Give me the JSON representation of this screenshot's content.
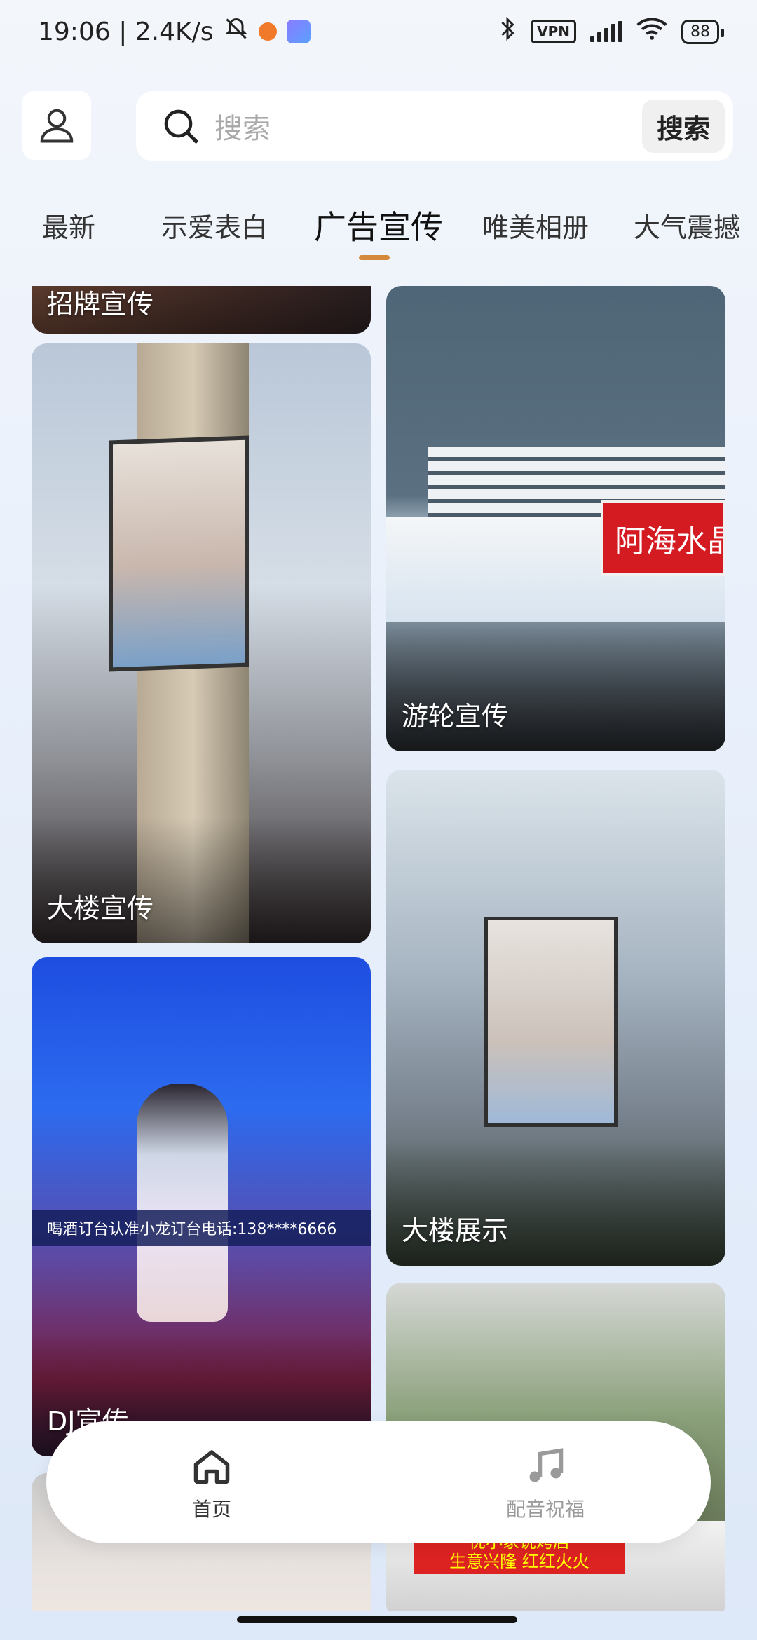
{
  "status_bar": {
    "time_speed": "19:06 | 2.4K/s",
    "vpn": "VPN",
    "battery": "88"
  },
  "search": {
    "placeholder": "搜索",
    "button_label": "搜索"
  },
  "tabs": [
    {
      "label": "最新"
    },
    {
      "label": "示爱表白"
    },
    {
      "label": "广告宣传",
      "active": true
    },
    {
      "label": "唯美相册"
    },
    {
      "label": "大气震撼"
    }
  ],
  "feed": {
    "cards": [
      {
        "label": "招牌宣传"
      },
      {
        "label": "大楼宣传"
      },
      {
        "label": "游轮宣传",
        "banner_text": "阿海水晶富"
      },
      {
        "label": "大楼展示"
      },
      {
        "label": "DJ宣传",
        "banner_text": "喝酒订台认准小龙订台电话:138****6666"
      },
      {
        "label": "",
        "banner_line1": "优小家说烤店",
        "banner_line2": "生意兴隆 红红火火"
      },
      {
        "label": ""
      }
    ]
  },
  "bottom_nav": {
    "items": [
      {
        "label": "首页",
        "icon": "home-icon",
        "active": true
      },
      {
        "label": "配音祝福",
        "icon": "music-note-icon",
        "active": false
      }
    ]
  },
  "colors": {
    "tab_indicator": "#d58a3b",
    "inactive_nav": "#9a9a9a"
  }
}
